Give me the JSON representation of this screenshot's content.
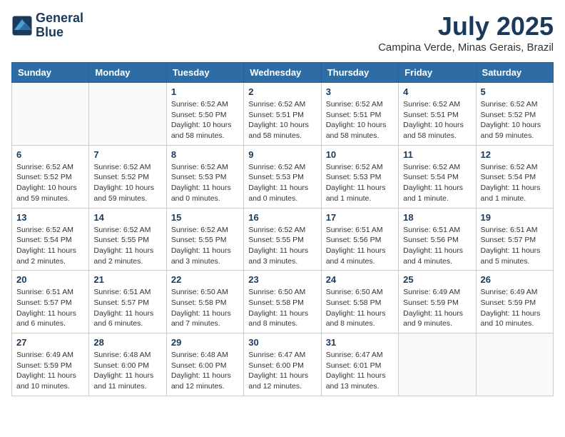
{
  "header": {
    "logo_line1": "General",
    "logo_line2": "Blue",
    "month_year": "July 2025",
    "location": "Campina Verde, Minas Gerais, Brazil"
  },
  "weekdays": [
    "Sunday",
    "Monday",
    "Tuesday",
    "Wednesday",
    "Thursday",
    "Friday",
    "Saturday"
  ],
  "weeks": [
    [
      {
        "day": "",
        "text": ""
      },
      {
        "day": "",
        "text": ""
      },
      {
        "day": "1",
        "text": "Sunrise: 6:52 AM\nSunset: 5:50 PM\nDaylight: 10 hours and 58 minutes."
      },
      {
        "day": "2",
        "text": "Sunrise: 6:52 AM\nSunset: 5:51 PM\nDaylight: 10 hours and 58 minutes."
      },
      {
        "day": "3",
        "text": "Sunrise: 6:52 AM\nSunset: 5:51 PM\nDaylight: 10 hours and 58 minutes."
      },
      {
        "day": "4",
        "text": "Sunrise: 6:52 AM\nSunset: 5:51 PM\nDaylight: 10 hours and 58 minutes."
      },
      {
        "day": "5",
        "text": "Sunrise: 6:52 AM\nSunset: 5:52 PM\nDaylight: 10 hours and 59 minutes."
      }
    ],
    [
      {
        "day": "6",
        "text": "Sunrise: 6:52 AM\nSunset: 5:52 PM\nDaylight: 10 hours and 59 minutes."
      },
      {
        "day": "7",
        "text": "Sunrise: 6:52 AM\nSunset: 5:52 PM\nDaylight: 10 hours and 59 minutes."
      },
      {
        "day": "8",
        "text": "Sunrise: 6:52 AM\nSunset: 5:53 PM\nDaylight: 11 hours and 0 minutes."
      },
      {
        "day": "9",
        "text": "Sunrise: 6:52 AM\nSunset: 5:53 PM\nDaylight: 11 hours and 0 minutes."
      },
      {
        "day": "10",
        "text": "Sunrise: 6:52 AM\nSunset: 5:53 PM\nDaylight: 11 hours and 1 minute."
      },
      {
        "day": "11",
        "text": "Sunrise: 6:52 AM\nSunset: 5:54 PM\nDaylight: 11 hours and 1 minute."
      },
      {
        "day": "12",
        "text": "Sunrise: 6:52 AM\nSunset: 5:54 PM\nDaylight: 11 hours and 1 minute."
      }
    ],
    [
      {
        "day": "13",
        "text": "Sunrise: 6:52 AM\nSunset: 5:54 PM\nDaylight: 11 hours and 2 minutes."
      },
      {
        "day": "14",
        "text": "Sunrise: 6:52 AM\nSunset: 5:55 PM\nDaylight: 11 hours and 2 minutes."
      },
      {
        "day": "15",
        "text": "Sunrise: 6:52 AM\nSunset: 5:55 PM\nDaylight: 11 hours and 3 minutes."
      },
      {
        "day": "16",
        "text": "Sunrise: 6:52 AM\nSunset: 5:55 PM\nDaylight: 11 hours and 3 minutes."
      },
      {
        "day": "17",
        "text": "Sunrise: 6:51 AM\nSunset: 5:56 PM\nDaylight: 11 hours and 4 minutes."
      },
      {
        "day": "18",
        "text": "Sunrise: 6:51 AM\nSunset: 5:56 PM\nDaylight: 11 hours and 4 minutes."
      },
      {
        "day": "19",
        "text": "Sunrise: 6:51 AM\nSunset: 5:57 PM\nDaylight: 11 hours and 5 minutes."
      }
    ],
    [
      {
        "day": "20",
        "text": "Sunrise: 6:51 AM\nSunset: 5:57 PM\nDaylight: 11 hours and 6 minutes."
      },
      {
        "day": "21",
        "text": "Sunrise: 6:51 AM\nSunset: 5:57 PM\nDaylight: 11 hours and 6 minutes."
      },
      {
        "day": "22",
        "text": "Sunrise: 6:50 AM\nSunset: 5:58 PM\nDaylight: 11 hours and 7 minutes."
      },
      {
        "day": "23",
        "text": "Sunrise: 6:50 AM\nSunset: 5:58 PM\nDaylight: 11 hours and 8 minutes."
      },
      {
        "day": "24",
        "text": "Sunrise: 6:50 AM\nSunset: 5:58 PM\nDaylight: 11 hours and 8 minutes."
      },
      {
        "day": "25",
        "text": "Sunrise: 6:49 AM\nSunset: 5:59 PM\nDaylight: 11 hours and 9 minutes."
      },
      {
        "day": "26",
        "text": "Sunrise: 6:49 AM\nSunset: 5:59 PM\nDaylight: 11 hours and 10 minutes."
      }
    ],
    [
      {
        "day": "27",
        "text": "Sunrise: 6:49 AM\nSunset: 5:59 PM\nDaylight: 11 hours and 10 minutes."
      },
      {
        "day": "28",
        "text": "Sunrise: 6:48 AM\nSunset: 6:00 PM\nDaylight: 11 hours and 11 minutes."
      },
      {
        "day": "29",
        "text": "Sunrise: 6:48 AM\nSunset: 6:00 PM\nDaylight: 11 hours and 12 minutes."
      },
      {
        "day": "30",
        "text": "Sunrise: 6:47 AM\nSunset: 6:00 PM\nDaylight: 11 hours and 12 minutes."
      },
      {
        "day": "31",
        "text": "Sunrise: 6:47 AM\nSunset: 6:01 PM\nDaylight: 11 hours and 13 minutes."
      },
      {
        "day": "",
        "text": ""
      },
      {
        "day": "",
        "text": ""
      }
    ]
  ]
}
